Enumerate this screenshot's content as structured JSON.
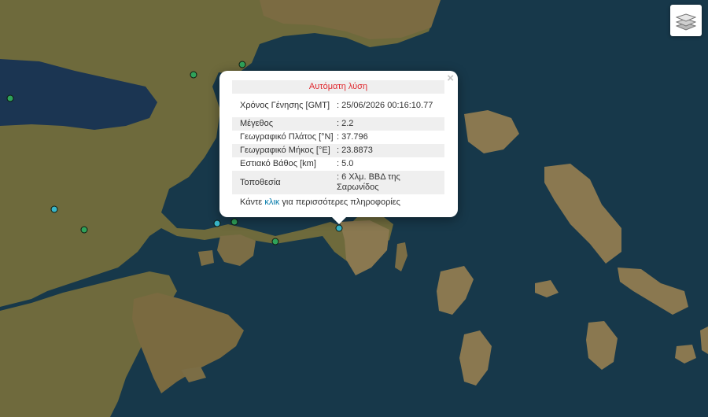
{
  "map": {
    "colors": {
      "sea": "#17384a",
      "land": "#7a6a40",
      "land_dark": "#4f5b30",
      "land_light": "#a08a5b"
    },
    "markers": [
      {
        "id": "m1",
        "color": "#2fa25a"
      },
      {
        "id": "m2",
        "color": "#2fa25a"
      },
      {
        "id": "m3",
        "color": "#2fa25a"
      },
      {
        "id": "m4",
        "color": "#38b6c9"
      },
      {
        "id": "m5",
        "color": "#2fa25a"
      },
      {
        "id": "m6",
        "color": "#38b6c9"
      },
      {
        "id": "m7",
        "color": "#2fa25a"
      },
      {
        "id": "m8",
        "color": "#2fa25a"
      },
      {
        "id": "selected",
        "color": "#38b6c9"
      }
    ]
  },
  "layers_control": {
    "icon": "layers-icon"
  },
  "popup": {
    "title": "Αυτόματη λύση",
    "close_label": "×",
    "rows": [
      {
        "label": "Χρόνος Γένησης [GMT]",
        "value": ": 25/06/2026 00:16:10.77"
      },
      {
        "label": "Μέγεθος",
        "value": ": 2.2"
      },
      {
        "label": "Γεωγραφικό Πλάτος [°N]",
        "value": ": 37.796"
      },
      {
        "label": "Γεωγραφικό Μήκος [°E]",
        "value": ": 23.8873"
      },
      {
        "label": "Εστιακό Βάθος [km]",
        "value": ": 5.0"
      },
      {
        "label": "Τοποθεσία",
        "value": ": 6 Χλμ. ΒΒΔ της Σαρωνίδος"
      }
    ],
    "more": {
      "prefix": "Κάντε ",
      "link": "κλικ",
      "suffix": " για περισσότερες πληροφορίες"
    }
  }
}
